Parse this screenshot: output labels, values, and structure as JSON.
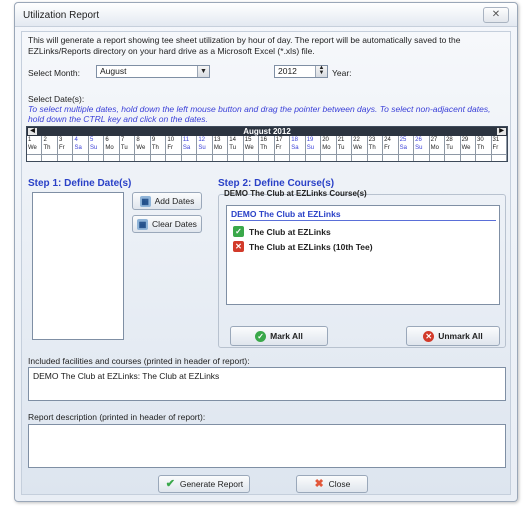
{
  "window": {
    "title": "Utilization Report",
    "close_glyph": "✕"
  },
  "intro": "This will generate a report showing tee sheet utilization by hour of day.  The report will be automatically saved to the EZLinks/Reports directory on your hard drive as a Microsoft Excel (*.xls) file.",
  "month": {
    "label": "Select Month:",
    "value": "August",
    "options": [
      "August"
    ]
  },
  "year": {
    "value": "2012",
    "label": "Year:"
  },
  "dates": {
    "label": "Select Date(s):",
    "hint": "To select multiple dates, hold down the left mouse button and drag the pointer between days.  To select non-adjacent dates, hold down the CTRL key and click on the dates."
  },
  "calendar": {
    "header": "August 2012",
    "prev": "◀",
    "next": "▶",
    "days": [
      {
        "num": "1",
        "dow": "We"
      },
      {
        "num": "2",
        "dow": "Th"
      },
      {
        "num": "3",
        "dow": "Fr"
      },
      {
        "num": "4",
        "dow": "Sa"
      },
      {
        "num": "5",
        "dow": "Su"
      },
      {
        "num": "6",
        "dow": "Mo"
      },
      {
        "num": "7",
        "dow": "Tu"
      },
      {
        "num": "8",
        "dow": "We"
      },
      {
        "num": "9",
        "dow": "Th"
      },
      {
        "num": "10",
        "dow": "Fr"
      },
      {
        "num": "11",
        "dow": "Sa"
      },
      {
        "num": "12",
        "dow": "Su"
      },
      {
        "num": "13",
        "dow": "Mo"
      },
      {
        "num": "14",
        "dow": "Tu"
      },
      {
        "num": "15",
        "dow": "We"
      },
      {
        "num": "16",
        "dow": "Th"
      },
      {
        "num": "17",
        "dow": "Fr"
      },
      {
        "num": "18",
        "dow": "Sa"
      },
      {
        "num": "19",
        "dow": "Su"
      },
      {
        "num": "20",
        "dow": "Mo"
      },
      {
        "num": "21",
        "dow": "Tu"
      },
      {
        "num": "22",
        "dow": "We"
      },
      {
        "num": "23",
        "dow": "Th"
      },
      {
        "num": "24",
        "dow": "Fr"
      },
      {
        "num": "25",
        "dow": "Sa"
      },
      {
        "num": "26",
        "dow": "Su"
      },
      {
        "num": "27",
        "dow": "Mo"
      },
      {
        "num": "28",
        "dow": "Tu"
      },
      {
        "num": "29",
        "dow": "We"
      },
      {
        "num": "30",
        "dow": "Th"
      },
      {
        "num": "31",
        "dow": "Fr"
      }
    ]
  },
  "step1": {
    "title": "Step 1: Define Date(s)",
    "add_label": "Add Dates",
    "clear_label": "Clear Dates"
  },
  "step2": {
    "title": "Step 2: Define Course(s)",
    "group_label": "DEMO The Club at EZLinks Course(s)",
    "facility": "DEMO The Club at EZLinks",
    "courses": [
      {
        "name": "The Club at EZLinks",
        "checked": true
      },
      {
        "name": "The Club at EZLinks (10th Tee)",
        "checked": false
      }
    ],
    "mark_all_label": "Mark All",
    "unmark_all_label": "Unmark All"
  },
  "included": {
    "label": "Included facilities and courses (printed in header of report):",
    "value": "DEMO The Club at EZLinks: The Club at EZLinks"
  },
  "description": {
    "label": "Report description (printed in header of report):",
    "value": ""
  },
  "footer": {
    "generate_label": "Generate Report",
    "close_label": "Close"
  },
  "colors": {
    "step_heading": "#2a41c7",
    "hint_text": "#3a3fd8",
    "checked": "#3aa84a",
    "unchecked": "#d23a2a"
  }
}
